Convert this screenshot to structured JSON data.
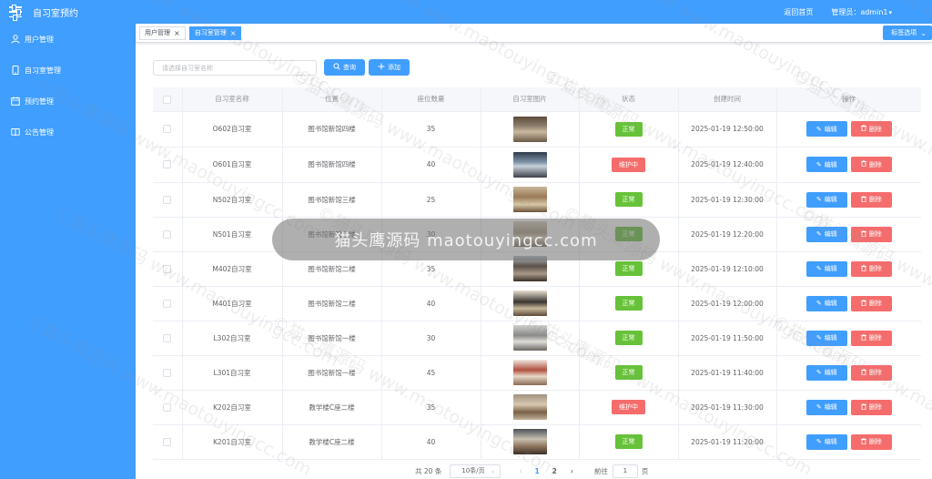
{
  "header": {
    "app_title": "自习室预约",
    "home_link": "返回首页",
    "admin_label": "管理员：admin1",
    "caret": "▾"
  },
  "sidebar": {
    "items": [
      {
        "label": "用户管理",
        "icon": "user-icon"
      },
      {
        "label": "自习室管理",
        "icon": "mobile-icon"
      },
      {
        "label": "预约管理",
        "icon": "calendar-icon"
      },
      {
        "label": "公告管理",
        "icon": "book-icon"
      }
    ]
  },
  "tabs": {
    "items": [
      {
        "label": "用户管理",
        "close": "×",
        "active": false
      },
      {
        "label": "自习室管理",
        "close": "×",
        "active": true
      }
    ],
    "options_label": "标签选项",
    "options_chevron": "⌄"
  },
  "toolbar": {
    "search_placeholder": "请选择自习室名称",
    "search_value": "",
    "query_label": "查询",
    "add_label": "添加",
    "query_icon": "search-icon",
    "add_icon": "plus-icon"
  },
  "table": {
    "columns": [
      "",
      "自习室名称",
      "位置",
      "座位数量",
      "自习室图片",
      "状态",
      "创建时间",
      "操作"
    ],
    "edit_label": "编辑",
    "delete_label": "删除",
    "rows": [
      {
        "name": "O602自习室",
        "location": "图书馆新馆四楼",
        "seats": "35",
        "status": "正常",
        "created": "2025-01-19 12:50:00"
      },
      {
        "name": "O601自习室",
        "location": "图书馆新馆四楼",
        "seats": "40",
        "status": "维护中",
        "created": "2025-01-19 12:40:00"
      },
      {
        "name": "N502自习室",
        "location": "图书馆新馆三楼",
        "seats": "25",
        "status": "正常",
        "created": "2025-01-19 12:30:00"
      },
      {
        "name": "N501自习室",
        "location": "图书馆新馆三楼",
        "seats": "30",
        "status": "正常",
        "created": "2025-01-19 12:20:00"
      },
      {
        "name": "M402自习室",
        "location": "图书馆新馆二楼",
        "seats": "35",
        "status": "正常",
        "created": "2025-01-19 12:10:00"
      },
      {
        "name": "M401自习室",
        "location": "图书馆新馆二楼",
        "seats": "40",
        "status": "正常",
        "created": "2025-01-19 12:00:00"
      },
      {
        "name": "L302自习室",
        "location": "图书馆新馆一楼",
        "seats": "30",
        "status": "正常",
        "created": "2025-01-19 11:50:00"
      },
      {
        "name": "L301自习室",
        "location": "图书馆新馆一楼",
        "seats": "45",
        "status": "正常",
        "created": "2025-01-19 11:40:00"
      },
      {
        "name": "K202自习室",
        "location": "教学楼C座二楼",
        "seats": "35",
        "status": "维护中",
        "created": "2025-01-19 11:30:00"
      },
      {
        "name": "K201自习室",
        "location": "教学楼C座二楼",
        "seats": "40",
        "status": "正常",
        "created": "2025-01-19 11:20:00"
      }
    ]
  },
  "pagination": {
    "total": "共 20 条",
    "page_size": "10条/页",
    "prev": "‹",
    "pages": [
      "1",
      "2"
    ],
    "current": "1",
    "next": "›",
    "goto_label": "前往",
    "goto_value": "1",
    "page_suffix": "页"
  },
  "watermark": {
    "banner": "猫头鹰源码 maotouyingcc.com",
    "text": "©猫头鹰源码 www.maotouyingcc.com"
  },
  "colors": {
    "primary": "#409eff",
    "success": "#67c23a",
    "danger": "#f56c6c"
  }
}
